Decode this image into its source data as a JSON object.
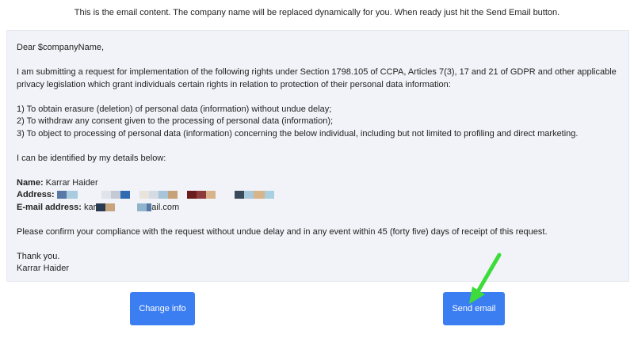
{
  "intro_text": "This is the email content. The company name will be replaced dynamically for you. When ready just hit the Send Email button.",
  "email": {
    "greeting": "Dear $companyName,",
    "paragraph1": "I am submitting a request for implementation of the following rights under Section 1798.105 of CCPA, Articles 7(3), 17 and 21 of GDPR and other applicable privacy legislation which grant individuals certain rights in relation to protection of their personal data information:",
    "right1": "1) To obtain erasure (deletion) of personal data (information) without undue delay;",
    "right2": "2) To withdraw any consent given to the processing of personal data (information);",
    "right3": "3) To object to processing of personal data (information) concerning the below individual, including but not limited to profiling and direct marketing.",
    "identify": "I can be identified by my details below:",
    "name_label": "Name:",
    "name_value": " Karrar Haider",
    "address_label": "Address:",
    "email_label": "E-mail address:",
    "email_prefix": " kar",
    "email_suffix": "ail.com",
    "confirm": "Please confirm your compliance with the request without undue delay and in any event within 45 (forty five) days of receipt of this request.",
    "thanks": "Thank you.",
    "signature": "Karrar Haider"
  },
  "buttons": {
    "change_info": "Change info",
    "send_email": "Send email"
  },
  "colors": {
    "button": "#3b7ef2",
    "email_bg": "#f1f3f8",
    "arrow": "#3ddc3a"
  }
}
